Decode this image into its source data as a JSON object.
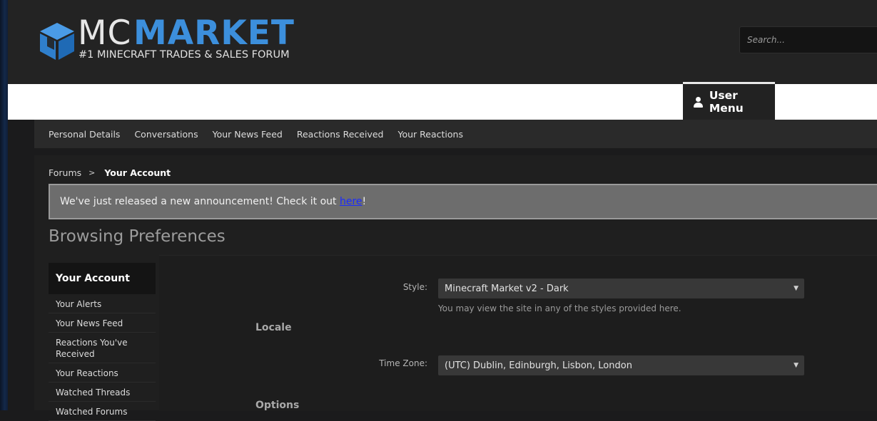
{
  "header": {
    "logo_mc": "MC",
    "logo_market": "MARKET",
    "logo_tagline": "#1 MINECRAFT TRADES & SALES FORUM",
    "search_placeholder": "Search..."
  },
  "nav": {
    "user_menu_label": "User Menu"
  },
  "subnav": {
    "items": [
      "Personal Details",
      "Conversations",
      "Your News Feed",
      "Reactions Received",
      "Your Reactions"
    ]
  },
  "breadcrumb": {
    "root": "Forums",
    "separator": ">",
    "current": "Your Account"
  },
  "notice": {
    "text": "We've just released a new announcement! Check it out ",
    "link": "here",
    "suffix": "!"
  },
  "page_title": "Browsing Preferences",
  "sidebar": {
    "heading": "Your Account",
    "items": [
      "Your Alerts",
      "Your News Feed",
      "Reactions You've Received",
      "Your Reactions",
      "Watched Threads",
      "Watched Forums"
    ]
  },
  "form": {
    "style_label": "Style:",
    "style_value": "Minecraft Market v2 - Dark",
    "style_hint": "You may view the site in any of the styles provided here.",
    "locale_heading": "Locale",
    "timezone_label": "Time Zone:",
    "timezone_value": "(UTC) Dublin, Edinburgh, Lisbon, London",
    "options_heading": "Options"
  },
  "colors": {
    "brand_blue": "#3c8fdc",
    "header_bg": "#232323",
    "link_blue": "#1a2bff"
  }
}
